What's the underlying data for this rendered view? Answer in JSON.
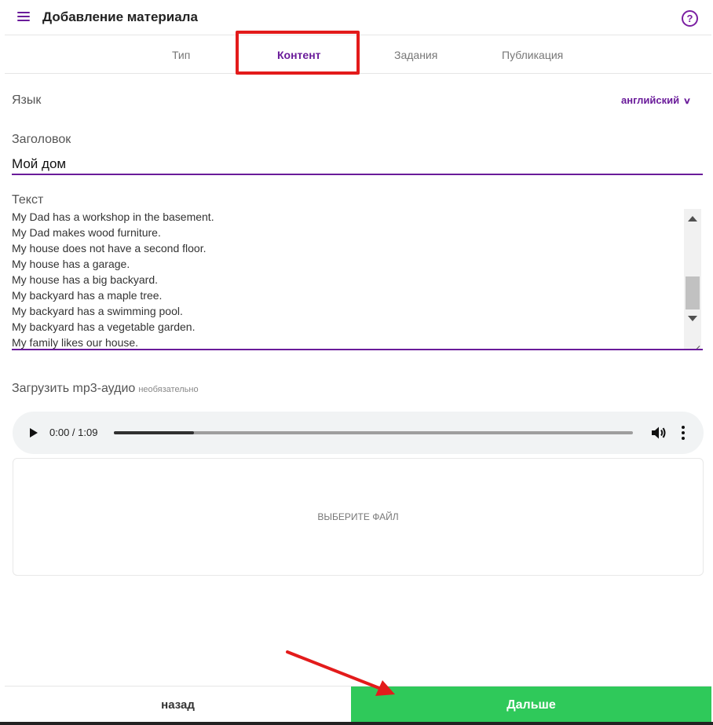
{
  "header": {
    "title": "Добавление материала",
    "help_glyph": "?",
    "menu_icon": "hamburger-menu-icon",
    "help_icon": "help-circle-icon"
  },
  "tabs": [
    {
      "label": "Тип",
      "active": false
    },
    {
      "label": "Контент",
      "active": true
    },
    {
      "label": "Задания",
      "active": false
    },
    {
      "label": "Публикация",
      "active": false
    }
  ],
  "form": {
    "language_label": "Язык",
    "language_value": "английский",
    "title_label": "Заголовок",
    "title_value": "Мой дом",
    "text_label": "Текст",
    "text_lines": [
      "My Dad has a workshop in the basement.",
      "My Dad makes wood furniture.",
      "My house does not have a second floor.",
      "My house has a garage.",
      "My house has a big backyard.",
      "My backyard has a maple tree.",
      "My backyard has a swimming pool.",
      "My backyard has a vegetable garden.",
      "My family likes our house."
    ],
    "upload_label": "Загрузить mp3-аудио",
    "upload_optional": "необязательно"
  },
  "audio": {
    "time": "0:00 / 1:09",
    "progress_fraction": 0.155
  },
  "file_drop": {
    "label": "ВЫБЕРИТЕ ФАЙЛ"
  },
  "footer": {
    "back_label": "назад",
    "next_label": "Дальше"
  },
  "colors": {
    "accent": "#6a1b9a",
    "next_button": "#2fc95a",
    "annotation": "#e31b1b"
  }
}
